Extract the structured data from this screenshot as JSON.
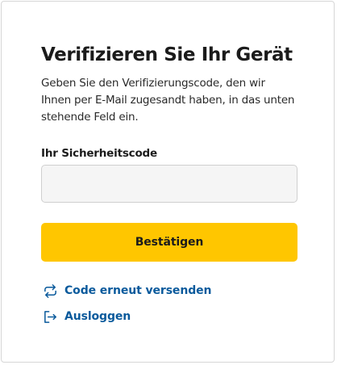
{
  "form": {
    "title": "Verifizieren Sie Ihr Gerät",
    "description": "Geben Sie den Verifizierungscode, den wir Ihnen per E-Mail zugesandt haben, in das unten stehende Feld ein.",
    "code_label": "Ihr Sicherheitscode",
    "code_value": "",
    "confirm_label": "Bestätigen"
  },
  "links": {
    "resend_label": "Code erneut versenden",
    "resend_icon": "repeat-icon",
    "logout_label": "Ausloggen",
    "logout_icon": "logout-icon"
  },
  "colors": {
    "accent_button": "#ffc600",
    "link": "#0a5a9c",
    "input_background": "#f5f5f5"
  }
}
